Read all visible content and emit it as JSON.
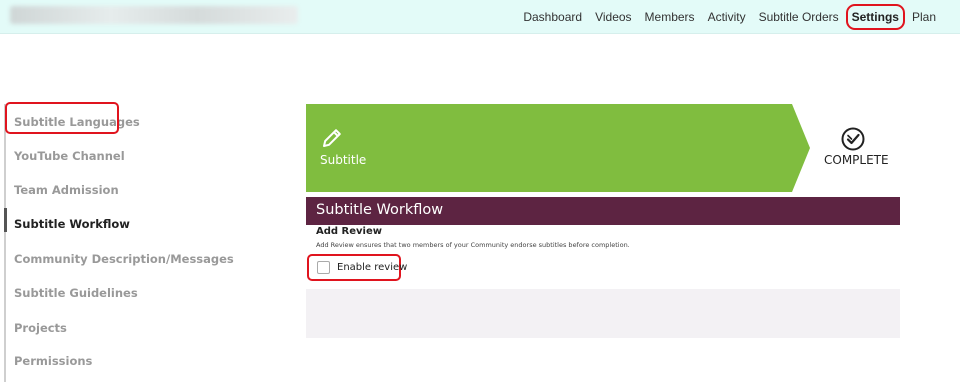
{
  "topbar": {
    "nav": [
      {
        "label": "Dashboard"
      },
      {
        "label": "Videos"
      },
      {
        "label": "Members"
      },
      {
        "label": "Activity"
      },
      {
        "label": "Subtitle Orders"
      },
      {
        "label": "Settings",
        "active": true
      },
      {
        "label": "Plan"
      }
    ]
  },
  "sidebar": {
    "items": [
      {
        "label": "Subtitle Languages"
      },
      {
        "label": "YouTube Channel"
      },
      {
        "label": "Team Admission"
      },
      {
        "label": "Subtitle Workflow",
        "active": true
      },
      {
        "label": "Community Description/Messages"
      },
      {
        "label": "Subtitle Guidelines"
      },
      {
        "label": "Projects"
      },
      {
        "label": "Permissions"
      }
    ]
  },
  "workflow": {
    "steps": [
      {
        "label": "Subtitle",
        "icon": "pencil-icon"
      },
      {
        "label": "COMPLETE",
        "icon": "check-circle-icon"
      }
    ],
    "section_title": "Subtitle Workflow",
    "add_review": {
      "title": "Add Review",
      "description": "Add Review ensures that two members of your Community endorse subtitles before completion.",
      "checkbox_label": "Enable review",
      "checked": false
    }
  },
  "colors": {
    "accent_green": "#80bd3f",
    "section_header": "#5d2442",
    "highlight_red": "#e0141e"
  }
}
